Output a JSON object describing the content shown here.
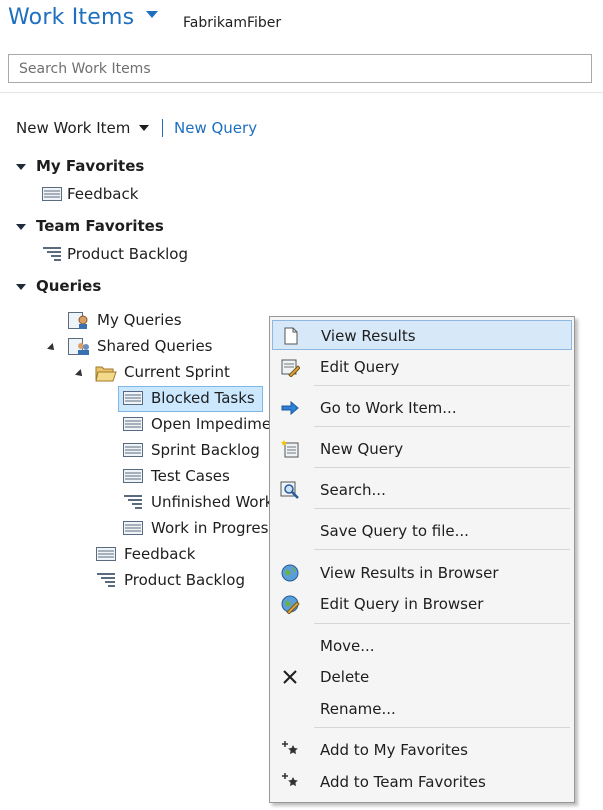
{
  "header": {
    "title": "Work Items",
    "project": "FabrikamFiber"
  },
  "search": {
    "placeholder": "Search Work Items"
  },
  "toolbar": {
    "new_work_item": "New Work Item",
    "new_query": "New Query"
  },
  "sections": {
    "my_favorites": {
      "title": "My Favorites",
      "items": [
        "Feedback"
      ]
    },
    "team_favorites": {
      "title": "Team Favorites",
      "items": [
        "Product Backlog"
      ]
    },
    "queries": {
      "title": "Queries"
    }
  },
  "tree": {
    "my_queries": "My Queries",
    "shared_queries": "Shared Queries",
    "current_sprint": "Current Sprint",
    "sprint_items": [
      "Blocked Tasks",
      "Open Impediments",
      "Sprint Backlog",
      "Test Cases",
      "Unfinished Work",
      "Work in Progress"
    ],
    "shared_items": [
      "Feedback",
      "Product Backlog"
    ]
  },
  "context_menu": {
    "items": [
      {
        "label": "View Results",
        "icon": "document-icon"
      },
      {
        "label": "Edit Query",
        "icon": "edit-query-icon"
      },
      {
        "label": "Go to Work Item...",
        "icon": "arrow-right-icon"
      },
      {
        "label": "New Query",
        "icon": "new-query-icon"
      },
      {
        "label": "Search...",
        "icon": "search-icon"
      },
      {
        "label": "Save Query to file...",
        "icon": ""
      },
      {
        "label": "View Results in Browser",
        "icon": "globe-icon"
      },
      {
        "label": "Edit Query in Browser",
        "icon": "globe-edit-icon"
      },
      {
        "label": "Move...",
        "icon": ""
      },
      {
        "label": "Delete",
        "icon": "delete-x-icon"
      },
      {
        "label": "Rename...",
        "icon": ""
      },
      {
        "label": "Add to My Favorites",
        "icon": "star-add-icon"
      },
      {
        "label": "Add to Team Favorites",
        "icon": "star-add-icon"
      }
    ]
  },
  "colors": {
    "accent": "#1e6fc0",
    "menu_bg": "#f5f5f5",
    "menu_highlight": "#d7e8f8",
    "selection": "#cce8ff"
  }
}
